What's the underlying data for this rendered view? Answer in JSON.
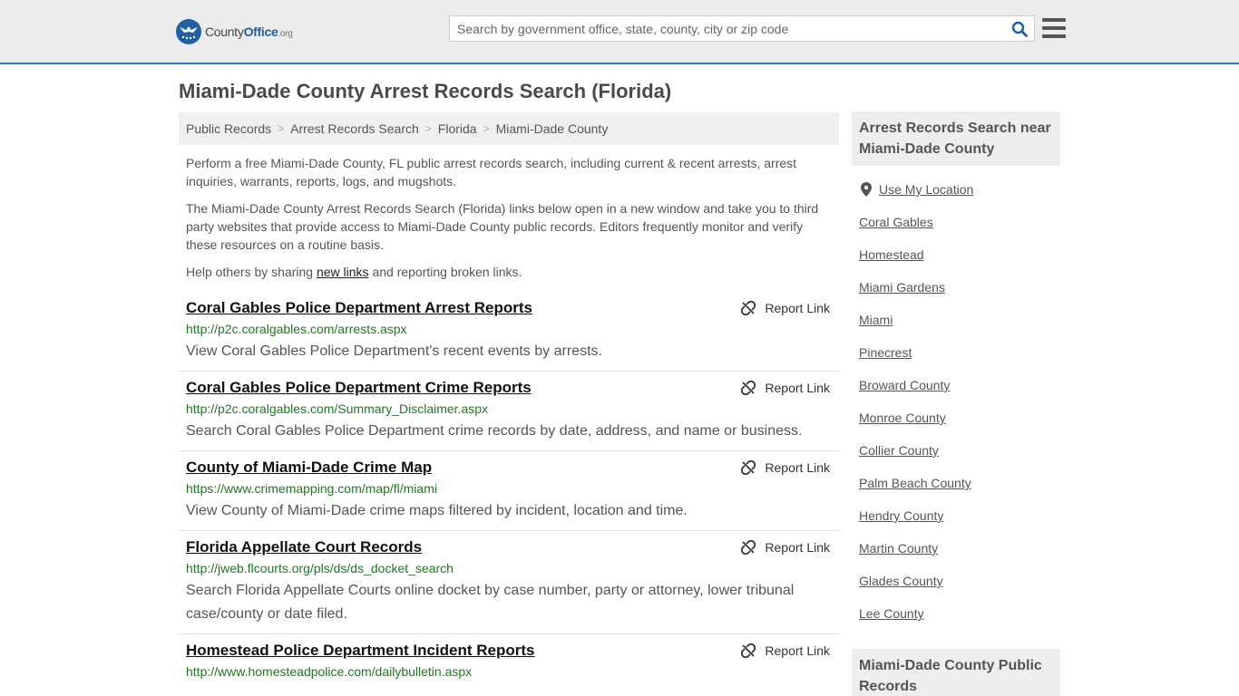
{
  "header": {
    "logo_county": "County",
    "logo_office": "Office",
    "logo_tld": ".org",
    "search_placeholder": "Search by government office, state, county, city or zip code"
  },
  "page_title": "Miami-Dade County Arrest Records Search (Florida)",
  "breadcrumb": [
    "Public Records",
    "Arrest Records Search",
    "Florida",
    "Miami-Dade County"
  ],
  "intro": {
    "p1": "Perform a free Miami-Dade County, FL public arrest records search, including current & recent arrests, arrest inquiries, warrants, reports, logs, and mugshots.",
    "p2": "The Miami-Dade County Arrest Records Search (Florida) links below open in a new window and take you to third party websites that provide access to Miami-Dade County public records. Editors frequently monitor and verify these resources on a routine basis.",
    "p3_before": "Help others by sharing ",
    "p3_link": "new links",
    "p3_after": " and reporting broken links."
  },
  "report_label": "Report Link",
  "results": [
    {
      "title": "Coral Gables Police Department Arrest Reports",
      "url": "http://p2c.coralgables.com/arrests.aspx",
      "desc": "View Coral Gables Police Department's recent events by arrests."
    },
    {
      "title": "Coral Gables Police Department Crime Reports",
      "url": "http://p2c.coralgables.com/Summary_Disclaimer.aspx",
      "desc": "Search Coral Gables Police Department crime records by date, address, and name or business."
    },
    {
      "title": "County of Miami-Dade Crime Map",
      "url": "https://www.crimemapping.com/map/fl/miami",
      "desc": "View County of Miami-Dade crime maps filtered by incident, location and time."
    },
    {
      "title": "Florida Appellate Court Records",
      "url": "http://jweb.flcourts.org/pls/ds/ds_docket_search",
      "desc": "Search Florida Appellate Courts online docket by case number, party or attorney, lower tribunal case/county or date filed."
    },
    {
      "title": "Homestead Police Department Incident Reports",
      "url": "http://www.homesteadpolice.com/dailybulletin.aspx",
      "desc": ""
    }
  ],
  "sidebar": {
    "heading": "Arrest Records Search near Miami-Dade County",
    "use_location": "Use My Location",
    "items": [
      "Coral Gables",
      "Homestead",
      "Miami Gardens",
      "Miami",
      "Pinecrest",
      "Broward County",
      "Monroe County",
      "Collier County",
      "Palm Beach County",
      "Hendry County",
      "Martin County",
      "Glades County",
      "Lee County"
    ],
    "heading2": "Miami-Dade County Public Records"
  },
  "colors": {
    "accent": "#2f7bbf",
    "logo_blue": "#1f5fa3",
    "url_green": "#1e7a1e"
  }
}
